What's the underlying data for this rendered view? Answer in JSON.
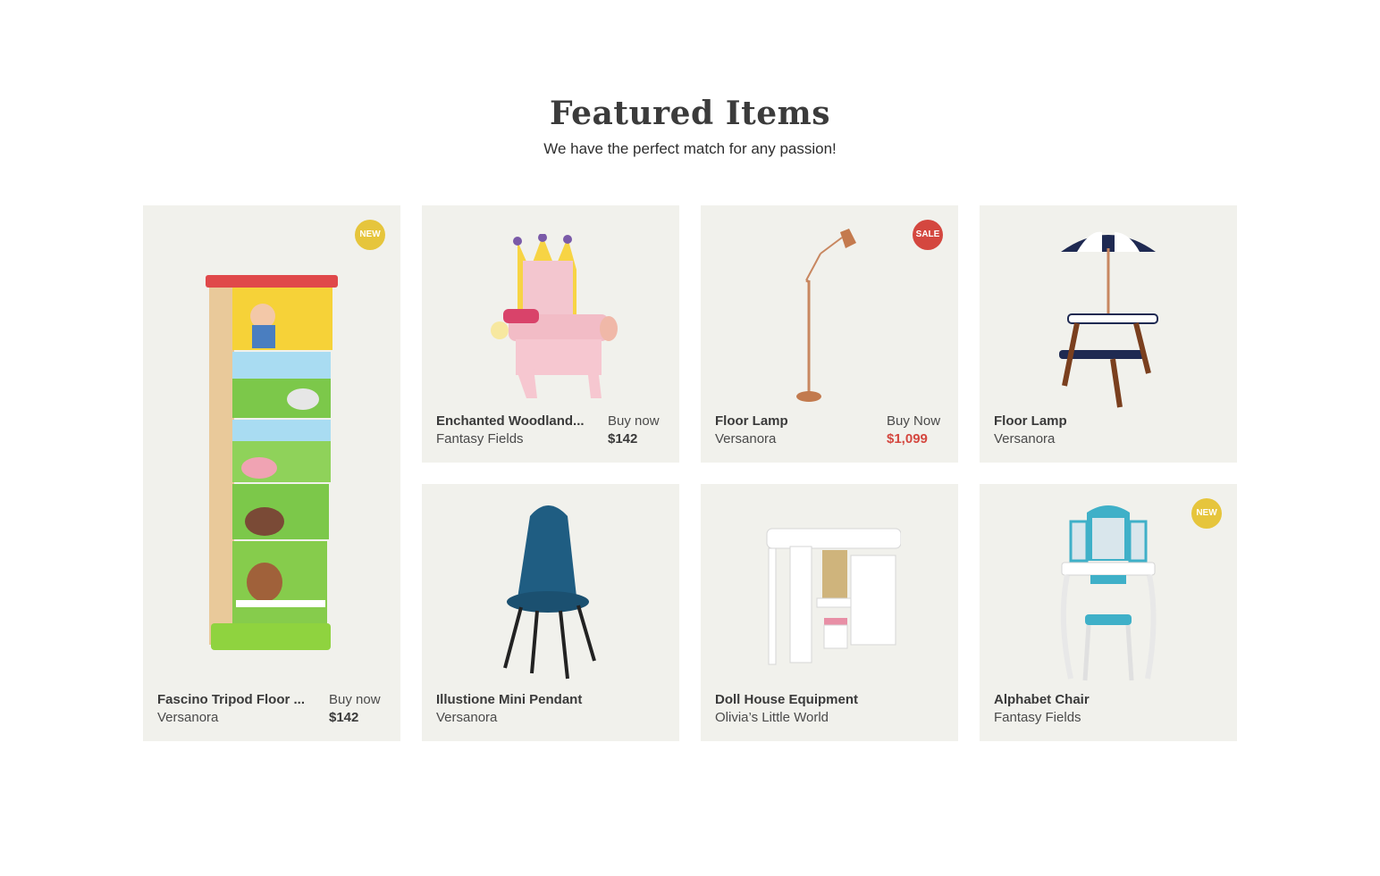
{
  "header": {
    "title": "Featured Items",
    "subtitle": "We have the perfect match for any passion!"
  },
  "colors": {
    "card_bg": "#f1f1ec",
    "new_badge": "#e6c53c",
    "sale_badge": "#d4473f"
  },
  "products": [
    {
      "name": "Fascino Tripod Floor ...",
      "brand": "Versanora",
      "buy_label": "Buy now",
      "price": "$142",
      "badge": "NEW",
      "image": "kids-tall-dresser"
    },
    {
      "name": "Enchanted Woodland...",
      "brand": "Fantasy Fields",
      "buy_label": "Buy now",
      "price": "$142",
      "badge": "",
      "image": "princess-throne-chair"
    },
    {
      "name": "Floor Lamp",
      "brand": "Versanora",
      "buy_label": "Buy Now",
      "price": "$1,099",
      "badge": "SALE",
      "image": "copper-floor-lamp"
    },
    {
      "name": "Floor Lamp",
      "brand": "Versanora",
      "buy_label": "",
      "price": "",
      "badge": "",
      "image": "picnic-table-umbrella"
    },
    {
      "name": "Illustione Mini Pendant",
      "brand": "Versanora",
      "buy_label": "",
      "price": "",
      "badge": "",
      "image": "blue-chair"
    },
    {
      "name": "Doll House Equipment",
      "brand": "Olivia’s Little World",
      "buy_label": "",
      "price": "",
      "badge": "",
      "image": "doll-loft-bed-desk"
    },
    {
      "name": "Alphabet Chair",
      "brand": "Fantasy Fields",
      "buy_label": "",
      "price": "",
      "badge": "NEW",
      "image": "vanity-table-stool"
    }
  ]
}
